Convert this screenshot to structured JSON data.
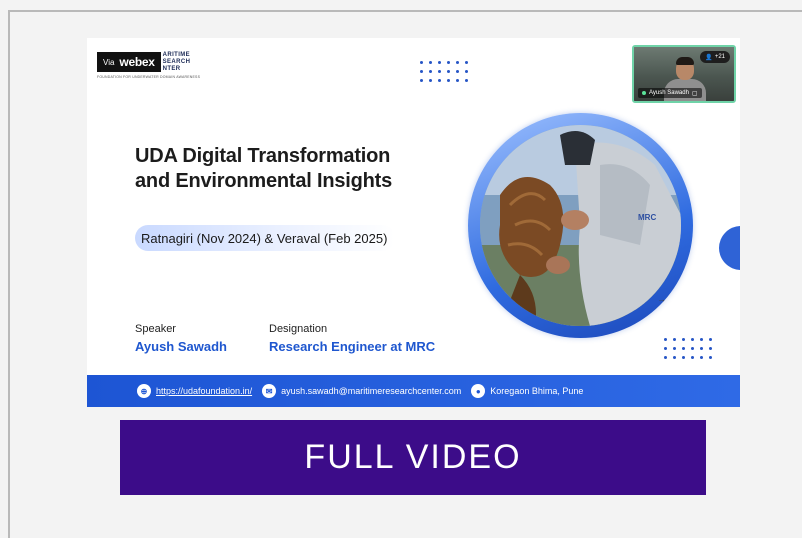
{
  "slide": {
    "brand": {
      "via": "Via",
      "webex": "webex",
      "org_lines": [
        "ARITIME",
        "SEARCH",
        "NTER"
      ],
      "tagline": "FOUNDATION FOR UNDERWATER DOMAIN AWARENESS"
    },
    "title_line1": "UDA Digital Transformation",
    "title_line2": "and Environmental Insights",
    "subtitle": "Ratnagiri (Nov 2024) & Veraval (Feb 2025)",
    "speaker_label": "Speaker",
    "speaker_name": "Ayush Sawadh",
    "designation_label": "Designation",
    "designation_value": "Research Engineer at MRC",
    "photo_logo": "MRC",
    "footer": {
      "website": "https://udafoundation.in/",
      "email": "ayush.sawadh@maritimeresearchcenter.com",
      "location": "Koregaon Bhima, Pune"
    },
    "colors": {
      "accent_blue": "#1f57cf",
      "footer_blue": "#1d55d4"
    }
  },
  "video_tile": {
    "participant_name": "Ayush Sawadh",
    "participant_count": "+21",
    "border_color": "#6fd3a8"
  },
  "button": {
    "label": "FULL VIDEO",
    "color": "#3c0c89"
  }
}
